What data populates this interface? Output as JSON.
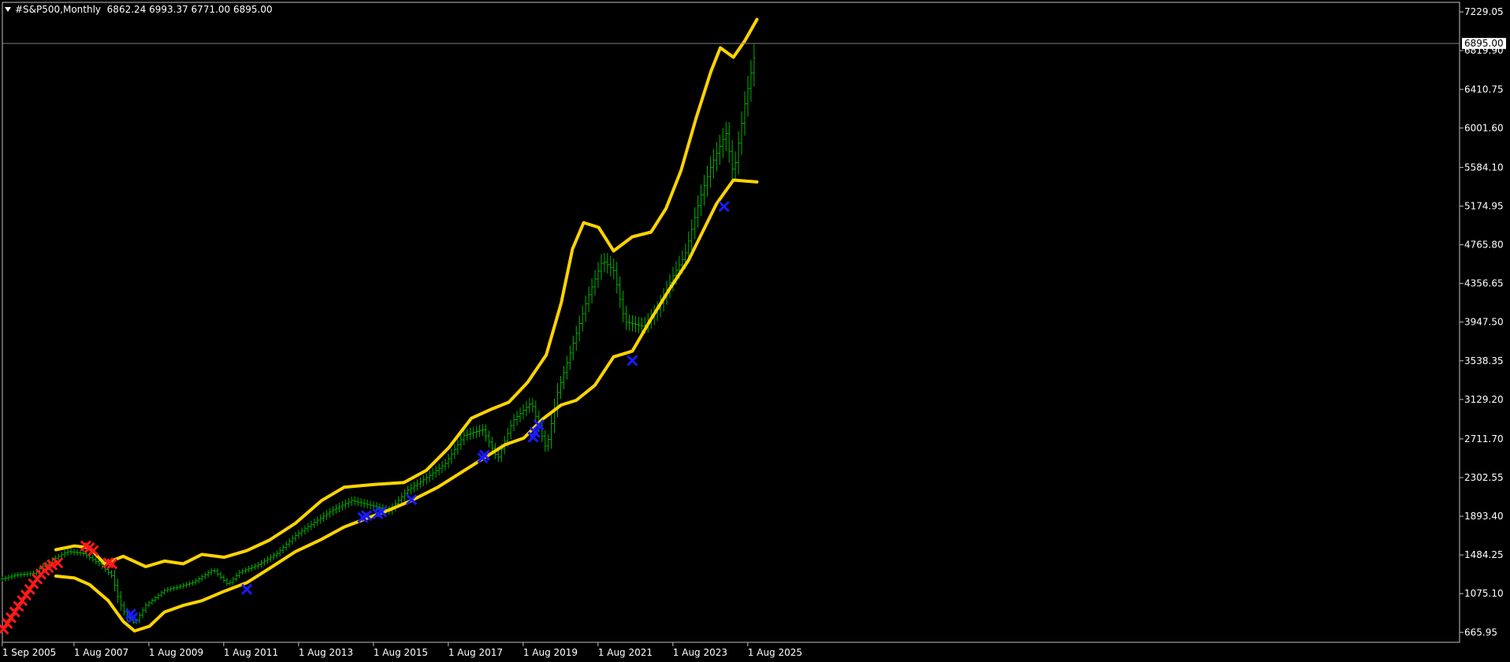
{
  "window": {
    "title_symbol": "#S&P500,Monthly",
    "title_ohlc": "6862.24 6993.37 6771.00 6895.00"
  },
  "colors": {
    "background": "#000000",
    "frame": "#c0c0c0",
    "text": "#ffffff",
    "bars": "#00b000",
    "bands": "#ffd400",
    "buy_marker": "#1a1aff",
    "sell_marker": "#ff1a1a",
    "price_line": "#808080",
    "price_label_bg": "#ffffff",
    "price_label_fg": "#000000"
  },
  "chart_data": {
    "type": "line",
    "symbol": "#S&P500",
    "timeframe": "Monthly",
    "current_price_label": "6895.00",
    "current_price": 6895.0,
    "yaxis_ticks": [
      "7229.05",
      "6819.90",
      "6410.75",
      "6001.60",
      "5584.10",
      "5174.95",
      "4765.80",
      "4356.65",
      "3947.50",
      "3538.35",
      "3129.20",
      "2711.70",
      "2302.55",
      "1893.40",
      "1484.25",
      "1075.10",
      "665.95"
    ],
    "xaxis_ticks": [
      "1 Sep 2005",
      "1 Aug 2007",
      "1 Aug 2009",
      "1 Aug 2011",
      "1 Aug 2013",
      "1 Aug 2015",
      "1 Aug 2017",
      "1 Aug 2019",
      "1 Aug 2021",
      "1 Aug 2023",
      "1 Aug 2025"
    ],
    "ylim": [
      560,
      7330
    ],
    "xlim": [
      2005.67,
      2044.6
    ],
    "grid": false,
    "series": [
      {
        "style": "price-bars",
        "points": [
          [
            2005.67,
            1230
          ],
          [
            2006.0,
            1270
          ],
          [
            2006.5,
            1290
          ],
          [
            2007.0,
            1430
          ],
          [
            2007.4,
            1520
          ],
          [
            2007.83,
            1500
          ],
          [
            2008.3,
            1380
          ],
          [
            2008.6,
            1260
          ],
          [
            2008.8,
            980
          ],
          [
            2009.0,
            820
          ],
          [
            2009.2,
            760
          ],
          [
            2009.5,
            950
          ],
          [
            2010.0,
            1110
          ],
          [
            2010.4,
            1150
          ],
          [
            2010.8,
            1200
          ],
          [
            2011.3,
            1330
          ],
          [
            2011.7,
            1170
          ],
          [
            2012.0,
            1300
          ],
          [
            2012.5,
            1380
          ],
          [
            2013.0,
            1500
          ],
          [
            2013.5,
            1690
          ],
          [
            2014.0,
            1830
          ],
          [
            2014.5,
            1960
          ],
          [
            2015.0,
            2060
          ],
          [
            2015.6,
            2000
          ],
          [
            2016.0,
            1950
          ],
          [
            2016.5,
            2170
          ],
          [
            2017.0,
            2300
          ],
          [
            2017.5,
            2450
          ],
          [
            2018.0,
            2750
          ],
          [
            2018.5,
            2810
          ],
          [
            2018.9,
            2500
          ],
          [
            2019.3,
            2900
          ],
          [
            2019.8,
            3100
          ],
          [
            2020.2,
            2600
          ],
          [
            2020.5,
            3200
          ],
          [
            2020.9,
            3700
          ],
          [
            2021.3,
            4200
          ],
          [
            2021.7,
            4600
          ],
          [
            2022.0,
            4500
          ],
          [
            2022.3,
            3950
          ],
          [
            2022.8,
            3900
          ],
          [
            2023.2,
            4100
          ],
          [
            2023.6,
            4450
          ],
          [
            2023.9,
            4650
          ],
          [
            2024.3,
            5250
          ],
          [
            2024.6,
            5600
          ],
          [
            2025.0,
            5950
          ],
          [
            2025.2,
            5500
          ],
          [
            2025.5,
            6250
          ],
          [
            2025.83,
            6895
          ]
        ]
      },
      {
        "style": "upper-band",
        "points": [
          [
            2007.1,
            1540
          ],
          [
            2007.6,
            1580
          ],
          [
            2008.0,
            1560
          ],
          [
            2008.4,
            1390
          ],
          [
            2008.9,
            1470
          ],
          [
            2009.5,
            1360
          ],
          [
            2010.0,
            1420
          ],
          [
            2010.5,
            1390
          ],
          [
            2011.0,
            1490
          ],
          [
            2011.6,
            1460
          ],
          [
            2012.2,
            1530
          ],
          [
            2012.8,
            1640
          ],
          [
            2013.5,
            1820
          ],
          [
            2014.2,
            2060
          ],
          [
            2014.8,
            2200
          ],
          [
            2015.6,
            2230
          ],
          [
            2016.4,
            2250
          ],
          [
            2017.0,
            2380
          ],
          [
            2017.6,
            2620
          ],
          [
            2018.2,
            2930
          ],
          [
            2018.7,
            3020
          ],
          [
            2019.2,
            3100
          ],
          [
            2019.7,
            3310
          ],
          [
            2020.2,
            3600
          ],
          [
            2020.6,
            4150
          ],
          [
            2020.9,
            4720
          ],
          [
            2021.2,
            5000
          ],
          [
            2021.6,
            4950
          ],
          [
            2022.0,
            4700
          ],
          [
            2022.5,
            4850
          ],
          [
            2023.0,
            4900
          ],
          [
            2023.4,
            5150
          ],
          [
            2023.8,
            5550
          ],
          [
            2024.2,
            6100
          ],
          [
            2024.6,
            6600
          ],
          [
            2024.85,
            6850
          ],
          [
            2025.2,
            6750
          ],
          [
            2025.5,
            6920
          ],
          [
            2025.83,
            7150
          ]
        ]
      },
      {
        "style": "lower-band",
        "points": [
          [
            2007.1,
            1260
          ],
          [
            2007.6,
            1240
          ],
          [
            2008.0,
            1170
          ],
          [
            2008.5,
            1000
          ],
          [
            2008.9,
            780
          ],
          [
            2009.2,
            680
          ],
          [
            2009.6,
            730
          ],
          [
            2010.0,
            880
          ],
          [
            2010.5,
            950
          ],
          [
            2011.0,
            1000
          ],
          [
            2011.6,
            1100
          ],
          [
            2012.2,
            1190
          ],
          [
            2012.8,
            1340
          ],
          [
            2013.5,
            1520
          ],
          [
            2014.2,
            1650
          ],
          [
            2014.8,
            1780
          ],
          [
            2015.4,
            1870
          ],
          [
            2016.0,
            1960
          ],
          [
            2016.6,
            2060
          ],
          [
            2017.3,
            2200
          ],
          [
            2017.9,
            2350
          ],
          [
            2018.5,
            2500
          ],
          [
            2019.1,
            2650
          ],
          [
            2019.6,
            2720
          ],
          [
            2020.1,
            2920
          ],
          [
            2020.6,
            3070
          ],
          [
            2021.0,
            3120
          ],
          [
            2021.5,
            3280
          ],
          [
            2022.0,
            3580
          ],
          [
            2022.5,
            3640
          ],
          [
            2023.0,
            3980
          ],
          [
            2023.5,
            4300
          ],
          [
            2024.0,
            4600
          ],
          [
            2024.5,
            5000
          ],
          [
            2024.75,
            5200
          ],
          [
            2025.2,
            5450
          ],
          [
            2025.83,
            5430
          ]
        ]
      }
    ],
    "markers": [
      {
        "kind": "sell",
        "points": [
          [
            2005.7,
            700
          ],
          [
            2005.8,
            760
          ],
          [
            2005.9,
            820
          ],
          [
            2006.0,
            880
          ],
          [
            2006.1,
            940
          ],
          [
            2006.2,
            1000
          ],
          [
            2006.3,
            1060
          ],
          [
            2006.4,
            1120
          ],
          [
            2006.5,
            1180
          ],
          [
            2006.6,
            1230
          ],
          [
            2006.7,
            1280
          ],
          [
            2006.8,
            1320
          ],
          [
            2006.9,
            1350
          ],
          [
            2007.0,
            1380
          ],
          [
            2007.15,
            1400
          ],
          [
            2007.9,
            1580
          ],
          [
            2008.0,
            1560
          ],
          [
            2008.1,
            1530
          ],
          [
            2008.5,
            1400
          ],
          [
            2008.6,
            1390
          ]
        ]
      },
      {
        "kind": "buy",
        "points": [
          [
            2009.1,
            860
          ],
          [
            2009.15,
            820
          ],
          [
            2012.2,
            1120
          ],
          [
            2015.3,
            1880
          ],
          [
            2015.4,
            1900
          ],
          [
            2015.7,
            1920
          ],
          [
            2015.8,
            1940
          ],
          [
            2016.6,
            2070
          ],
          [
            2018.5,
            2510
          ],
          [
            2018.55,
            2540
          ],
          [
            2019.85,
            2730
          ],
          [
            2019.9,
            2780
          ],
          [
            2020.0,
            2860
          ],
          [
            2022.5,
            3540
          ],
          [
            2024.95,
            5170
          ]
        ]
      }
    ]
  }
}
